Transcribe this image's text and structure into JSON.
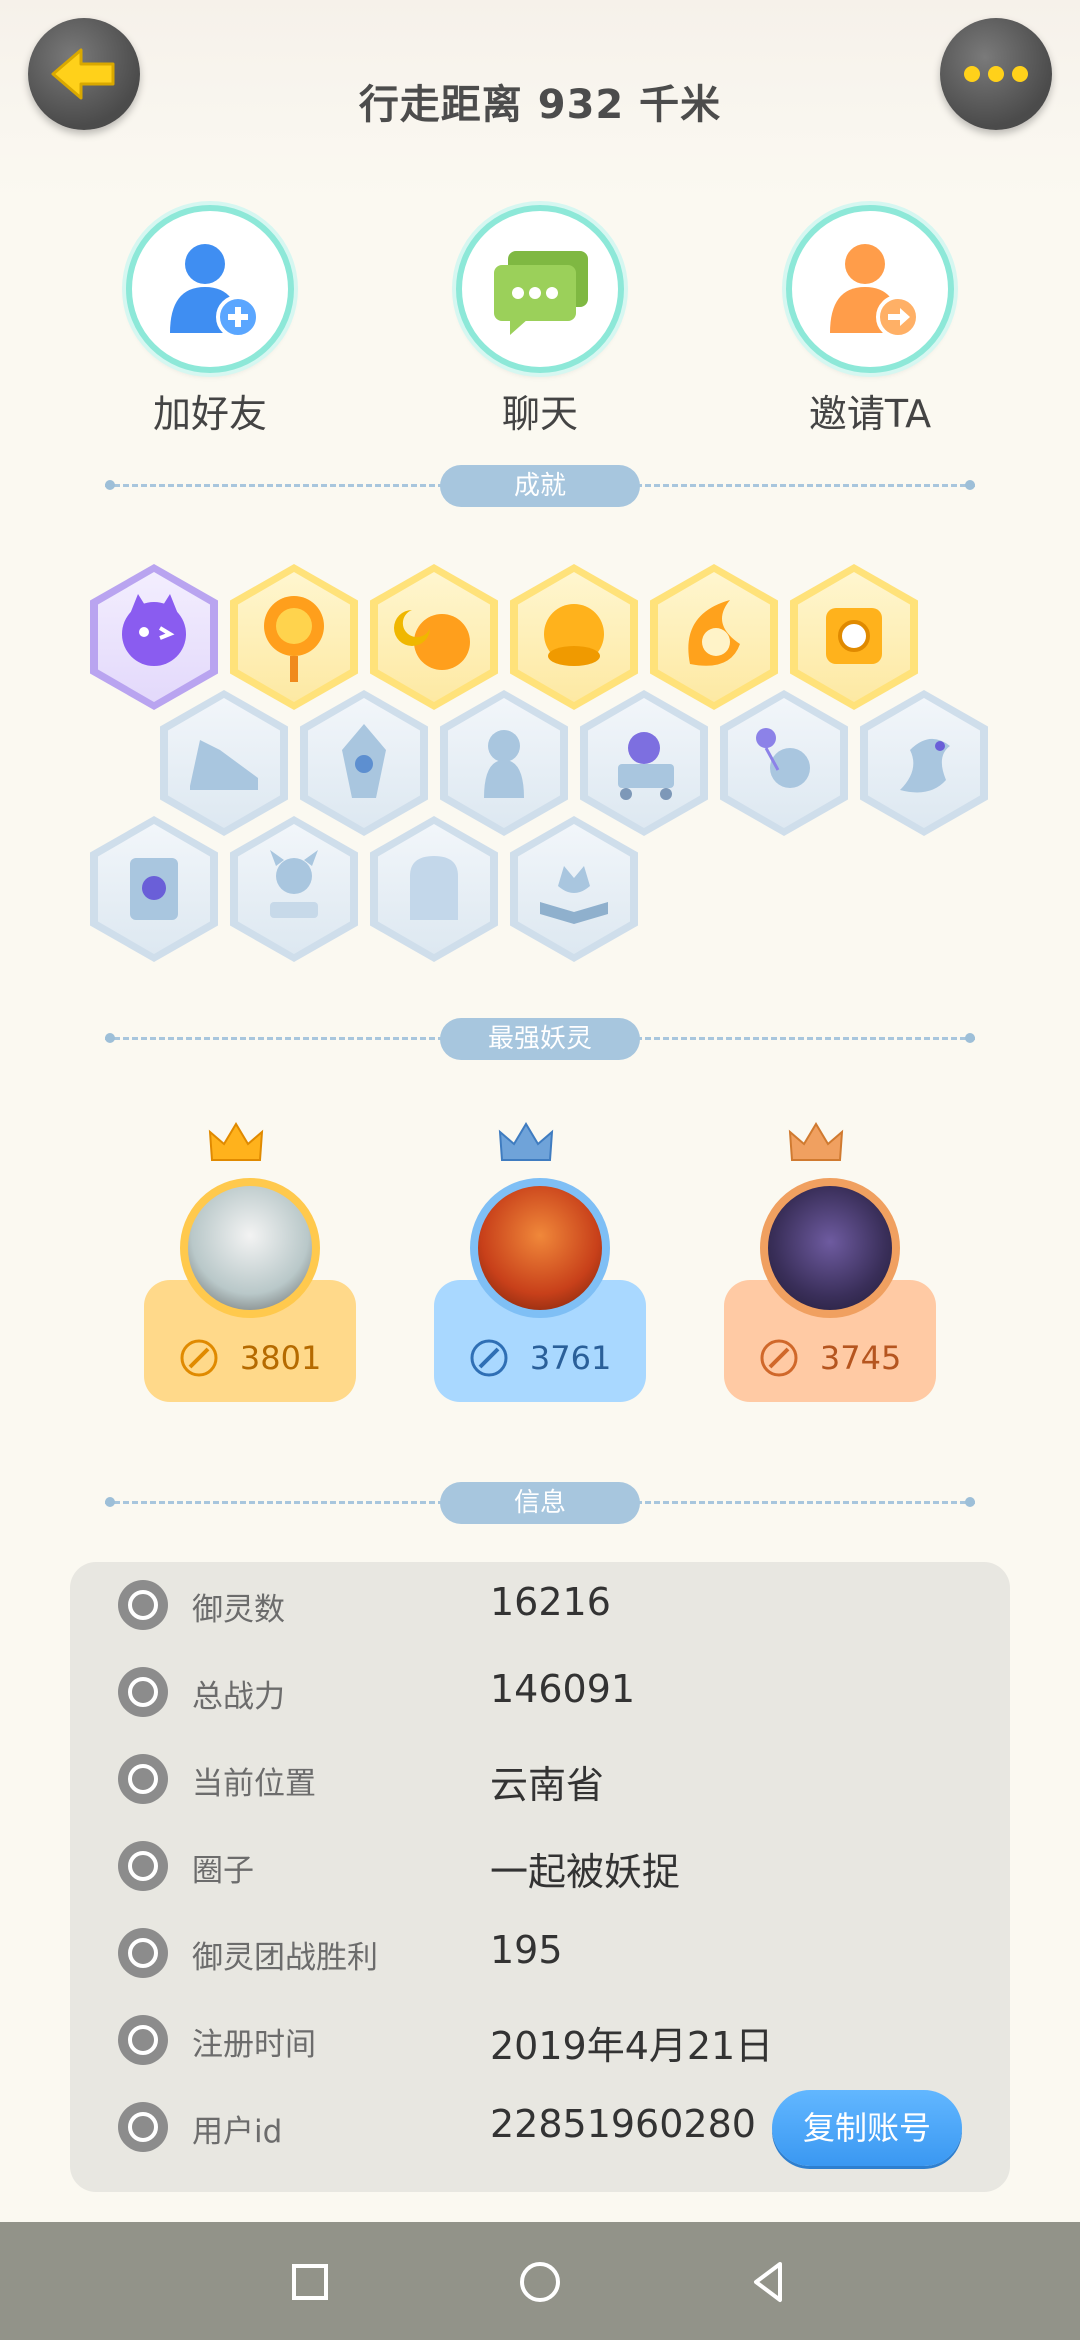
{
  "header": {
    "distance_text": "行走距离 932 千米"
  },
  "actions": [
    {
      "label": "加好友"
    },
    {
      "label": "聊天"
    },
    {
      "label": "邀请TA"
    }
  ],
  "sections": {
    "achievements": "成就",
    "strongest": "最强妖灵",
    "info": "信息"
  },
  "achievements": {
    "row1": [
      "purple-cat-badge-icon",
      "sun-badge-icon",
      "moon-sun-badge-icon",
      "gold-orb-badge-icon",
      "taiji-flame-badge-icon",
      "taiji-cube-badge-icon"
    ],
    "row2": [
      "sneaker-badge-icon",
      "crystal-badge-icon",
      "spirit-badge-icon",
      "cat-cart-badge-icon",
      "cat-balloon-badge-icon",
      "dragon-badge-icon"
    ],
    "row3": [
      "scroll-badge-icon",
      "horned-spirit-badge-icon",
      "ghost-cat-badge-icon",
      "fox-book-badge-icon"
    ]
  },
  "spirits": [
    {
      "power": "3801",
      "color": "#ffd98a"
    },
    {
      "power": "3761",
      "color": "#a9d8ff"
    },
    {
      "power": "3745",
      "color": "#ffcaa4"
    }
  ],
  "info": {
    "rows": [
      {
        "key": "御灵数",
        "value": "16216"
      },
      {
        "key": "总战力",
        "value": "146091"
      },
      {
        "key": "当前位置",
        "value": "云南省"
      },
      {
        "key": "圈子",
        "value": "一起被妖捉"
      },
      {
        "key": "御灵团战胜利",
        "value": "195"
      },
      {
        "key": "注册时间",
        "value": "2019年4月21日"
      },
      {
        "key": "用户id",
        "value": "22851960280"
      }
    ],
    "copy_button": "复制账号"
  }
}
